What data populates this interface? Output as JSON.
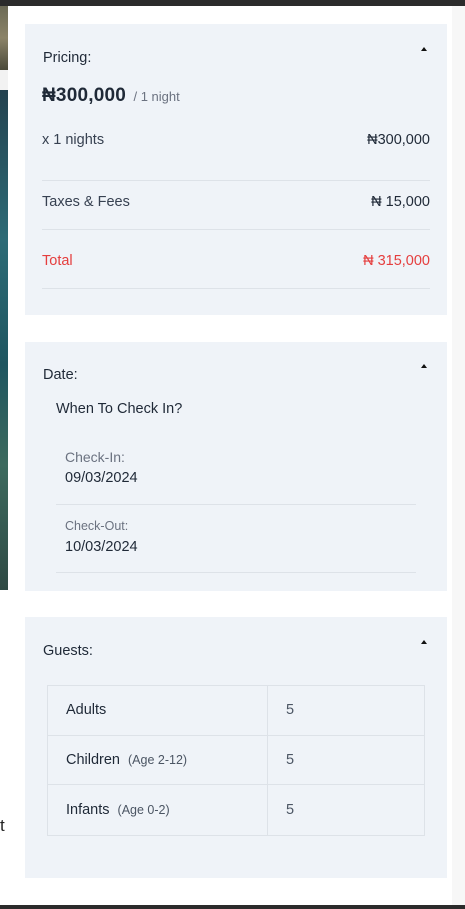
{
  "pricing": {
    "heading": "Pricing:",
    "price": "₦300,000",
    "unit": "/ 1 night",
    "nights_label": "x 1 nights",
    "nights_amount": "₦300,000",
    "taxes_label": "Taxes & Fees",
    "taxes_amount": "₦ 15,000",
    "total_label": "Total",
    "total_amount": "₦ 315,000"
  },
  "date": {
    "heading": "Date:",
    "question": "When To Check In?",
    "checkin_label": "Check-In:",
    "checkin_value": "09/03/2024",
    "checkout_label": "Check-Out:",
    "checkout_value": "10/03/2024"
  },
  "guests": {
    "heading": "Guests:",
    "rows": [
      {
        "label": "Adults",
        "age": "",
        "value": "5"
      },
      {
        "label": "Children",
        "age": "(Age 2-12)",
        "value": "5"
      },
      {
        "label": "Infants",
        "age": "(Age 0-2)",
        "value": "5"
      }
    ]
  },
  "backdrop": {
    "edge_letter": "t"
  },
  "colors": {
    "accent_total": "#e53e3e",
    "card_bg": "#eff3f8"
  },
  "icons": {
    "collapse": "caret-up-icon"
  }
}
